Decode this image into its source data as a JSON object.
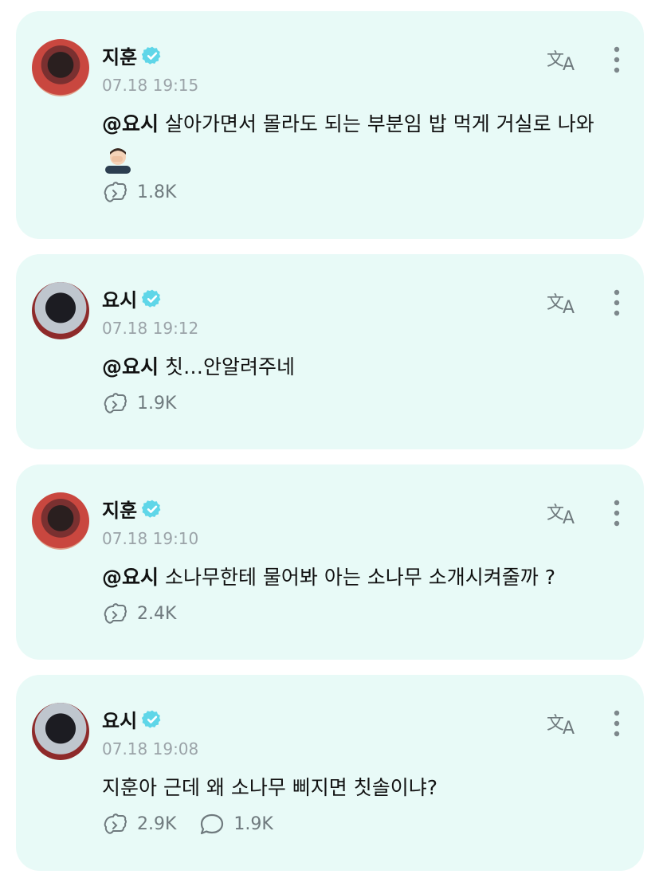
{
  "colors": {
    "card_bg": "#e8faf7",
    "verified": "#5fd6e8",
    "meta": "#9ba3a8",
    "icon": "#6f7a7e"
  },
  "posts": [
    {
      "author": "지훈",
      "time": "07.18 19:15",
      "mention": "@요시",
      "text": " 살아가면서 몰라도 되는 부분임 밥 먹게 거실로 나와 ",
      "emoji": "person-facepalming-emoji",
      "likes": "1.8K",
      "comments": null
    },
    {
      "author": "요시",
      "time": "07.18 19:12",
      "mention": "@요시",
      "text": " 칫…안알려주네",
      "likes": "1.9K",
      "comments": null
    },
    {
      "author": "지훈",
      "time": "07.18 19:10",
      "mention": "@요시",
      "text": " 소나무한테 물어봐 아는 소나무 소개시켜줄까 ?",
      "likes": "2.4K",
      "comments": null
    },
    {
      "author": "요시",
      "time": "07.18 19:08",
      "mention": "",
      "text": "지훈아 근데 왜 소나무 삐지면 칫솔이냐?",
      "likes": "2.9K",
      "comments": "1.9K"
    }
  ]
}
